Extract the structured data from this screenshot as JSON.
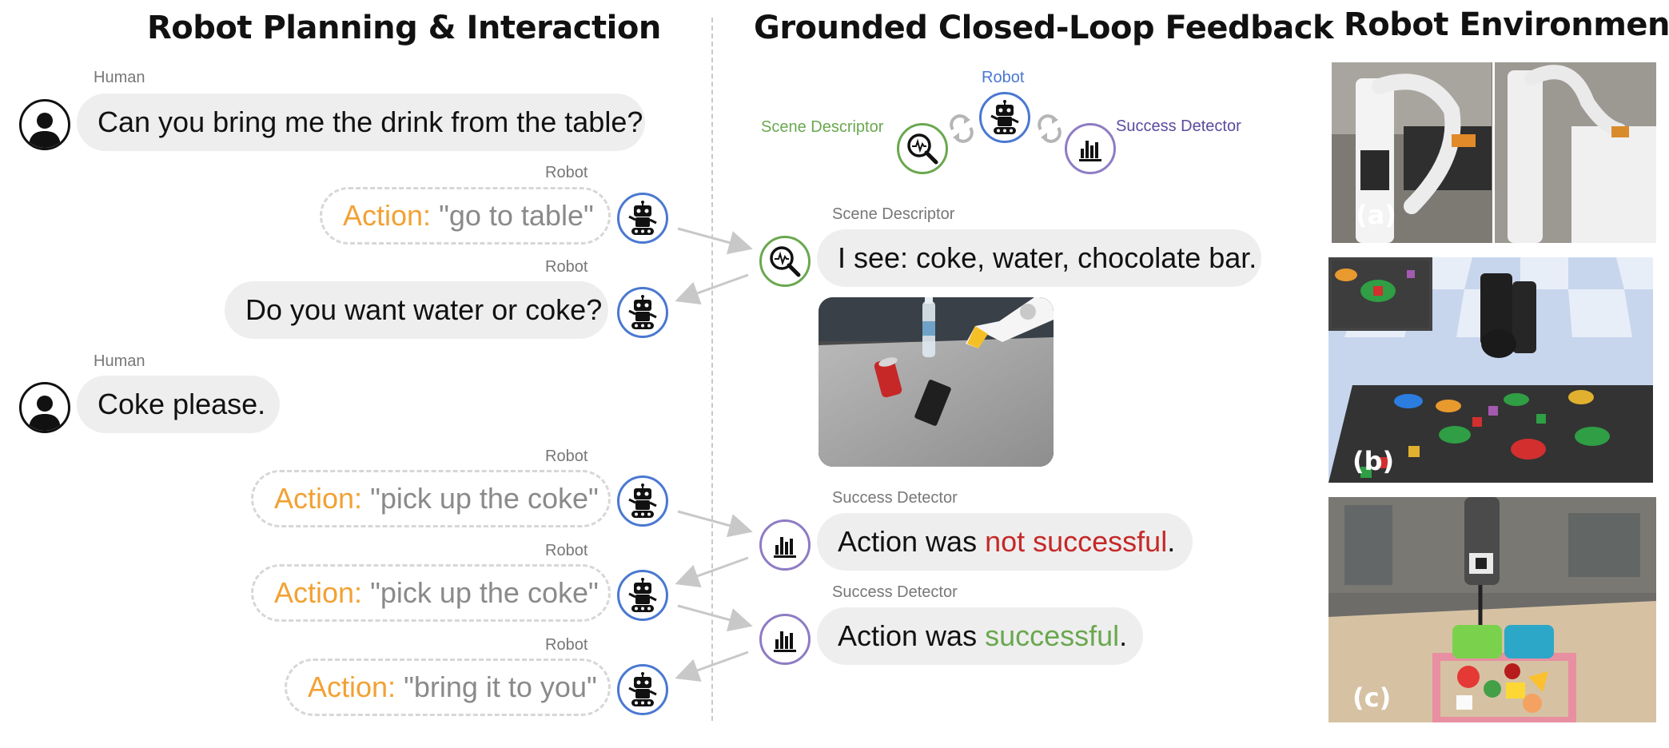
{
  "headings": {
    "left": "Robot Planning & Interaction",
    "middle": "Grounded Closed-Loop Feedback",
    "right": "Robot Environments"
  },
  "conversation": [
    {
      "speaker": "Human",
      "type": "message",
      "text": "Can you bring me the drink from the table?"
    },
    {
      "speaker": "Robot",
      "type": "action",
      "action_label": "Action:",
      "action_value": "\"go to table\""
    },
    {
      "speaker": "Robot",
      "type": "message",
      "text": "Do you want water or coke?"
    },
    {
      "speaker": "Human",
      "type": "message",
      "text": "Coke please."
    },
    {
      "speaker": "Robot",
      "type": "action",
      "action_label": "Action:",
      "action_value": "\"pick up the coke\""
    },
    {
      "speaker": "Robot",
      "type": "action",
      "action_label": "Action:",
      "action_value": "\"pick up the coke\""
    },
    {
      "speaker": "Robot",
      "type": "action",
      "action_label": "Action:",
      "action_value": "\"bring it to you\""
    }
  ],
  "loop_diagram": {
    "robot_label": "Robot",
    "scene_label": "Scene Descriptor",
    "success_label": "Success Detector"
  },
  "feedback": [
    {
      "speaker": "Scene Descriptor",
      "text": "I see: coke, water, chocolate bar."
    },
    {
      "speaker": "Success Detector",
      "prefix": "Action was ",
      "highlight": "not successful",
      "suffix": ".",
      "highlight_color": "#c62828"
    },
    {
      "speaker": "Success Detector",
      "prefix": "Action was ",
      "highlight": "successful",
      "suffix": ".",
      "highlight_color": "#6aa84f"
    }
  ],
  "environments": [
    {
      "label": "(a)"
    },
    {
      "label": "(b)"
    },
    {
      "label": "(c)"
    }
  ],
  "colors": {
    "robot_ring": "#4a78d1",
    "scene_ring": "#6aa84f",
    "success_ring": "#8e7cc3",
    "action_key": "#f2a133",
    "not_successful": "#c62828",
    "successful": "#6aa84f"
  }
}
